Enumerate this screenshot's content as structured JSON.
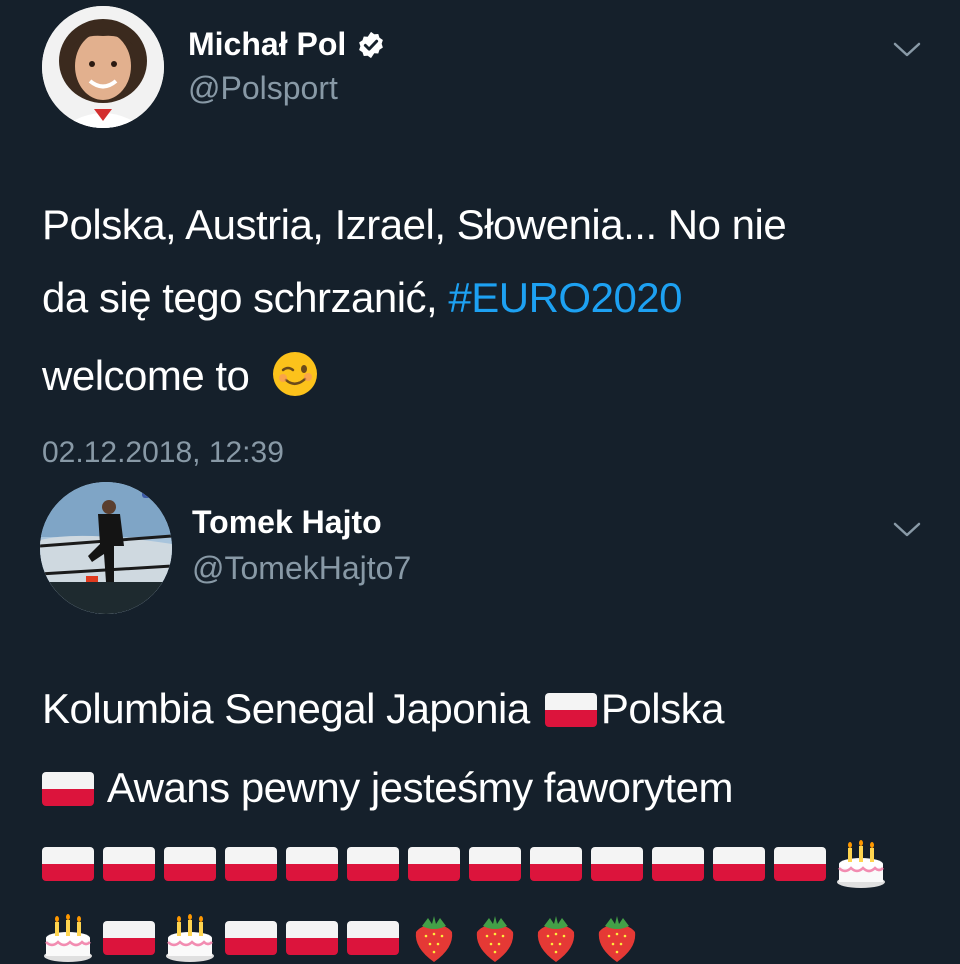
{
  "tweet1": {
    "author_name": "Michał Pol",
    "author_handle": "@Polsport",
    "text_line1": "Polska, Austria, Izrael, Słowenia... No nie",
    "text_line2_start": "da się tego schrzanić, ",
    "hashtag": "#EURO2020",
    "text_line3": "welcome to",
    "timestamp": "02.12.2018, 12:39"
  },
  "tweet2": {
    "author_name": "Tomek Hajto",
    "author_handle": "@TomekHajto7",
    "text_line1_a": "Kolumbia Senegal Japonia ",
    "text_line1_b": "Polska",
    "text_line2": " Awans pewny jesteśmy faworytem"
  },
  "colors": {
    "background": "#15202b",
    "text": "#ffffff",
    "secondary": "#8899a6",
    "link": "#1da1f2"
  },
  "icons": [
    "verified-badge-icon",
    "chevron-down-icon",
    "winking-face-emoji",
    "poland-flag-emoji",
    "birthday-cake-emoji",
    "strawberry-emoji"
  ]
}
